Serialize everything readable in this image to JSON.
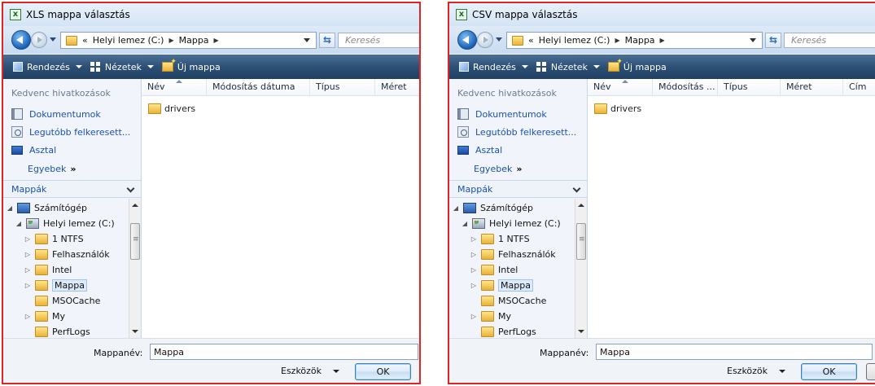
{
  "dialogs": [
    {
      "title": "XLS mappa választás",
      "app_icon": "excel-icon",
      "breadcrumb": [
        "Helyi lemez (C:)",
        "Mappa"
      ],
      "breadcrumb_overflow": "«",
      "search_placeholder": "Keresés",
      "toolbar": {
        "organize": "Rendezés",
        "views": "Nézetek",
        "new_folder": "Új mappa"
      },
      "favorites_header": "Kedvenc hivatkozások",
      "favorites": [
        "Dokumentumok",
        "Legutóbb felkeresett...",
        "Asztal"
      ],
      "favorites_more": "Egyebek",
      "folders_header": "Mappák",
      "tree": [
        {
          "label": "Számítógép",
          "level": 0,
          "toggle": "◢",
          "icon": "computer"
        },
        {
          "label": "Helyi lemez (C:)",
          "level": 1,
          "toggle": "◢",
          "icon": "drive"
        },
        {
          "label": "1 NTFS",
          "level": 2,
          "toggle": "▷",
          "icon": "folder"
        },
        {
          "label": "Felhasználók",
          "level": 2,
          "toggle": "▷",
          "icon": "folder"
        },
        {
          "label": "Intel",
          "level": 2,
          "toggle": "▷",
          "icon": "folder"
        },
        {
          "label": "Mappa",
          "level": 2,
          "toggle": "▷",
          "icon": "folder",
          "selected": true
        },
        {
          "label": "MSOCache",
          "level": 2,
          "toggle": "",
          "icon": "folder"
        },
        {
          "label": "My",
          "level": 2,
          "toggle": "▷",
          "icon": "folder"
        },
        {
          "label": "PerfLogs",
          "level": 2,
          "toggle": "",
          "icon": "folder"
        }
      ],
      "columns": [
        "Név",
        "Módosítás dátuma",
        "Típus",
        "Méret"
      ],
      "files": [
        "drivers"
      ],
      "filename_label": "Mappanév:",
      "filename_value": "Mappa",
      "tools_label": "Eszközök",
      "ok_label": "OK"
    },
    {
      "title": "CSV mappa választás",
      "app_icon": "excel-icon",
      "breadcrumb": [
        "Helyi lemez (C:)",
        "Mappa"
      ],
      "breadcrumb_overflow": "«",
      "search_placeholder": "Keresés",
      "toolbar": {
        "organize": "Rendezés",
        "views": "Nézetek",
        "new_folder": "Új mappa"
      },
      "favorites_header": "Kedvenc hivatkozások",
      "favorites": [
        "Dokumentumok",
        "Legutóbb felkeresett...",
        "Asztal"
      ],
      "favorites_more": "Egyebek",
      "folders_header": "Mappák",
      "tree": [
        {
          "label": "Számítógép",
          "level": 0,
          "toggle": "◢",
          "icon": "computer"
        },
        {
          "label": "Helyi lemez (C:)",
          "level": 1,
          "toggle": "◢",
          "icon": "drive"
        },
        {
          "label": "1 NTFS",
          "level": 2,
          "toggle": "▷",
          "icon": "folder"
        },
        {
          "label": "Felhasználók",
          "level": 2,
          "toggle": "▷",
          "icon": "folder"
        },
        {
          "label": "Intel",
          "level": 2,
          "toggle": "▷",
          "icon": "folder"
        },
        {
          "label": "Mappa",
          "level": 2,
          "toggle": "▷",
          "icon": "folder",
          "selected": true
        },
        {
          "label": "MSOCache",
          "level": 2,
          "toggle": "",
          "icon": "folder"
        },
        {
          "label": "My",
          "level": 2,
          "toggle": "▷",
          "icon": "folder"
        },
        {
          "label": "PerfLogs",
          "level": 2,
          "toggle": "",
          "icon": "folder"
        }
      ],
      "columns": [
        "Név",
        "Módosítás ...",
        "Típus",
        "Méret",
        "Cím"
      ],
      "files": [
        "drivers"
      ],
      "filename_label": "Mappanév:",
      "filename_value": "Mappa",
      "tools_label": "Eszközök",
      "ok_label": "OK"
    }
  ],
  "colors": {
    "highlight_border": "#e02424",
    "toolbar": "#2d5076",
    "link": "#1c52a7"
  }
}
